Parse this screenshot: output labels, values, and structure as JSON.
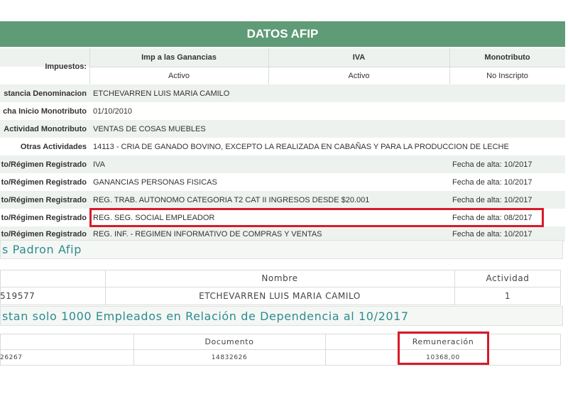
{
  "header": {
    "title": "DATOS AFIP"
  },
  "impuestos": {
    "label": "Impuestos:",
    "cols": [
      "Imp a las Ganancias",
      "IVA",
      "Monotributo"
    ],
    "vals": [
      "Activo",
      "Activo",
      "No Inscripto"
    ]
  },
  "rows": [
    {
      "label": "stancia Denominacion",
      "value": "ETCHEVARREN LUIS MARIA CAMILO",
      "date": ""
    },
    {
      "label": "cha Inicio Monotributo",
      "value": "01/10/2010",
      "date": ""
    },
    {
      "label": "Actividad Monotributo",
      "value": "VENTAS DE COSAS MUEBLES",
      "date": ""
    },
    {
      "label": "Otras Actividades",
      "value": "14113 - CRIA DE GANADO BOVINO, EXCEPTO LA REALIZADA EN CABAÑAS Y PARA LA PRODUCCION DE LECHE",
      "date": ""
    },
    {
      "label": "to/Régimen Registrado",
      "value": "IVA",
      "date": "Fecha de alta: 10/2017"
    },
    {
      "label": "to/Régimen Registrado",
      "value": "GANANCIAS PERSONAS FISICAS",
      "date": "Fecha de alta: 10/2017"
    },
    {
      "label": "to/Régimen Registrado",
      "value": "REG. TRAB. AUTONOMO CATEGORIA T2 CAT II INGRESOS DESDE $20.001",
      "date": "Fecha de alta: 10/2017"
    },
    {
      "label": "to/Régimen Registrado",
      "value": "REG. SEG. SOCIAL EMPLEADOR",
      "date": "Fecha de alta: 08/2017"
    },
    {
      "label": "to/Régimen Registrado",
      "value": "REG. INF. - REGIMEN INFORMATIVO DE COMPRAS Y VENTAS",
      "date": "Fecha de alta: 10/2017"
    }
  ],
  "padron": {
    "title": "s Padron Afip",
    "headers": [
      "",
      "Nombre",
      "Actividad"
    ],
    "row": [
      "519577",
      "ETCHEVARREN LUIS MARIA CAMILO",
      "1"
    ]
  },
  "empleados": {
    "title": "stan solo 1000 Empleados en Relación de Dependencia al 10/2017",
    "headers": [
      "",
      "Documento",
      "Remuneración"
    ],
    "row": [
      "26267",
      "14832626",
      "10368,00"
    ]
  },
  "colors": {
    "header": "#5f9b76",
    "highlight": "#d81a2a",
    "section_text": "#2d8c8f"
  }
}
